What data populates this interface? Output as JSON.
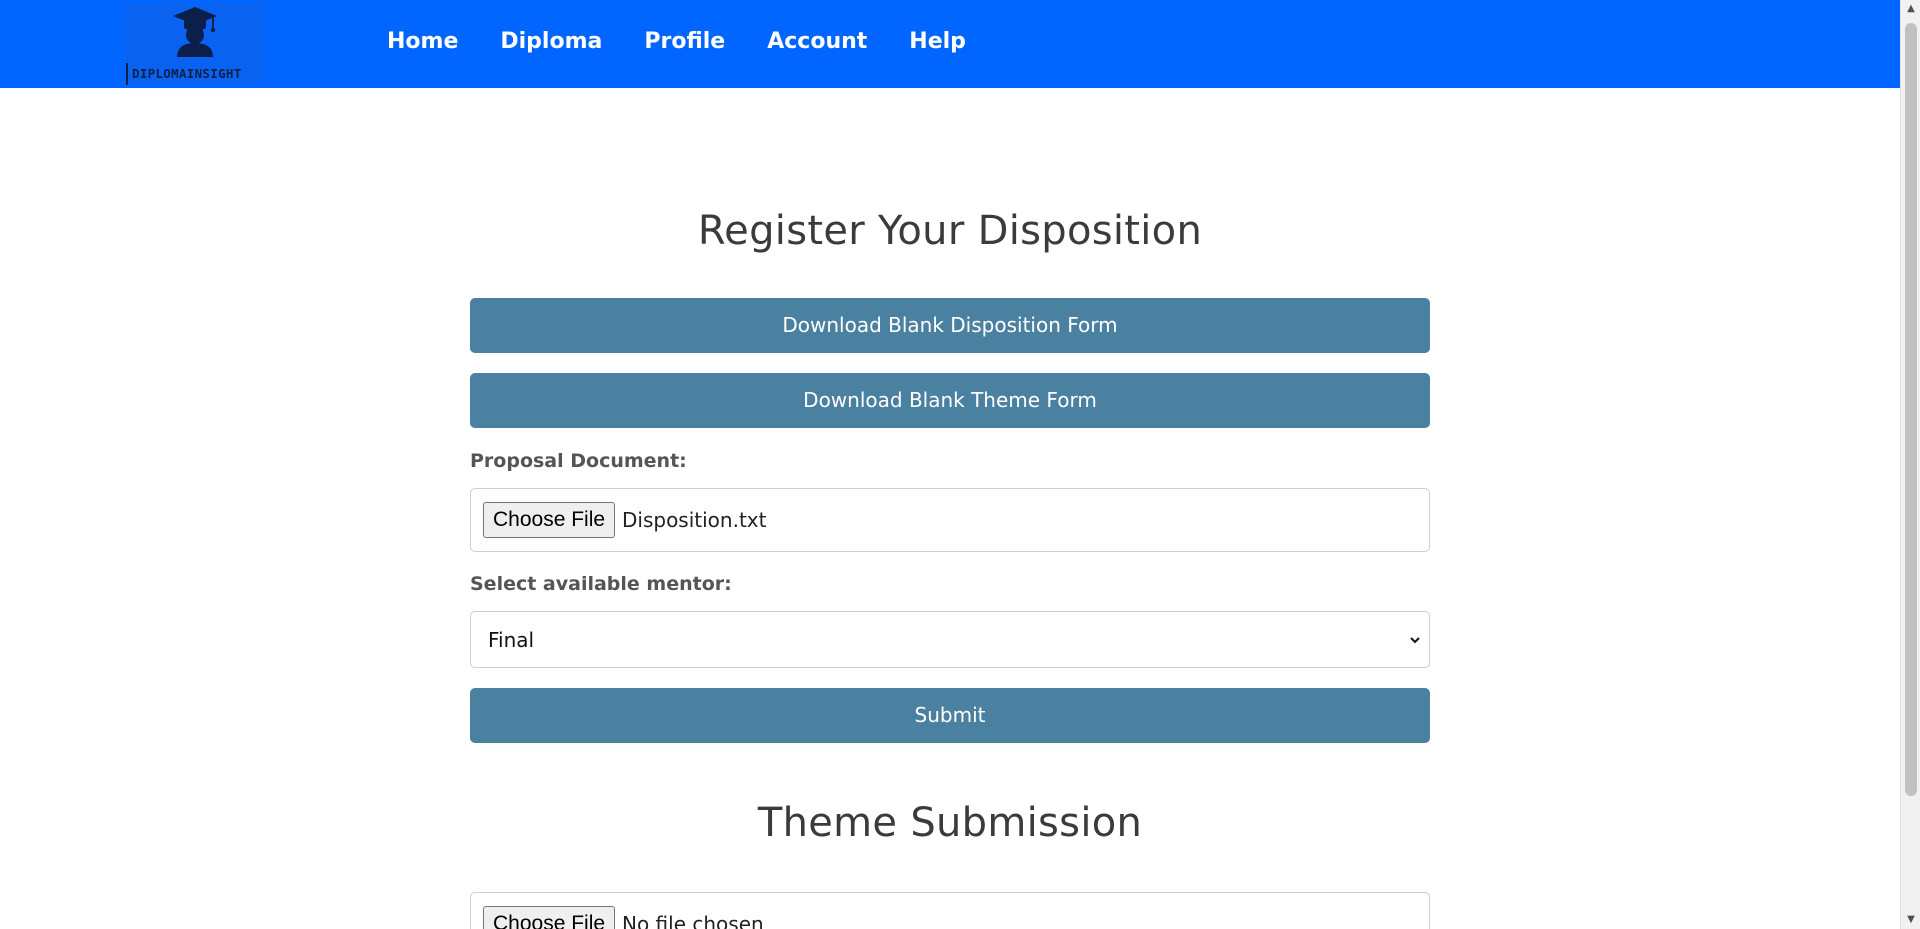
{
  "header": {
    "logo_text": "DIPLOMAINSIGHT",
    "nav": [
      "Home",
      "Diploma",
      "Profile",
      "Account",
      "Help"
    ]
  },
  "disposition": {
    "title": "Register Your Disposition",
    "download_disposition_label": "Download Blank Disposition Form",
    "download_theme_label": "Download Blank Theme Form",
    "proposal_label": "Proposal Document:",
    "proposal_file_button": "Choose File",
    "proposal_file_name": "Disposition.txt",
    "mentor_label": "Select available mentor:",
    "mentor_selected": "Final",
    "submit_label": "Submit"
  },
  "theme": {
    "title": "Theme Submission",
    "file_button": "Choose File",
    "file_name": "No file chosen"
  },
  "colors": {
    "navbar": "#0166ff",
    "button": "#4a81a1"
  }
}
